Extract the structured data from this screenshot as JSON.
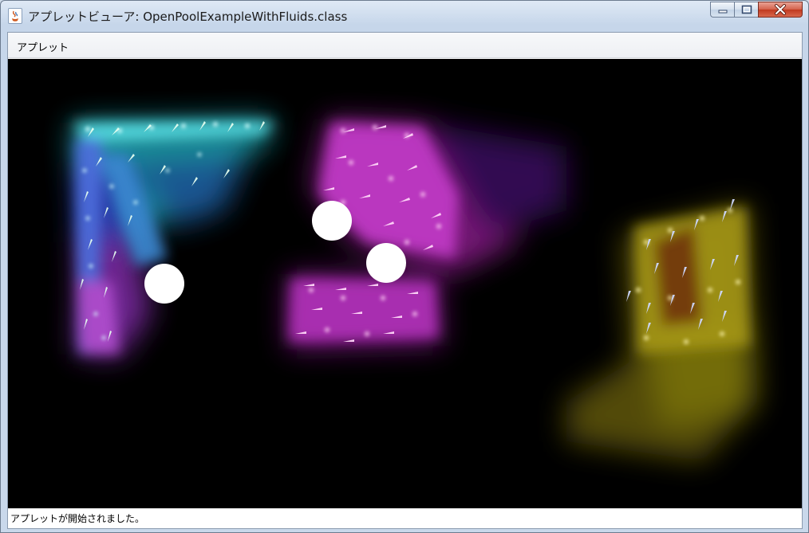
{
  "window": {
    "title": "アプレットビューア: OpenPoolExampleWithFluids.class",
    "icon": "java-coffee-icon"
  },
  "menu": {
    "items": [
      {
        "label": "アプレット"
      }
    ]
  },
  "canvas": {
    "background": "#000000",
    "fluids": [
      {
        "name": "cyan-blue-fluid",
        "colors": [
          "#46d8e0",
          "#3a63d6",
          "#a040c8"
        ]
      },
      {
        "name": "magenta-fluid",
        "colors": [
          "#d04ad8",
          "#f0a0e8"
        ]
      },
      {
        "name": "yellow-fluid",
        "colors": [
          "#c8c200",
          "#8a7a10"
        ]
      }
    ],
    "balls": [
      {
        "name": "ball-1"
      },
      {
        "name": "ball-2"
      },
      {
        "name": "ball-3"
      }
    ]
  },
  "status": {
    "text": "アプレットが開始されました。"
  }
}
